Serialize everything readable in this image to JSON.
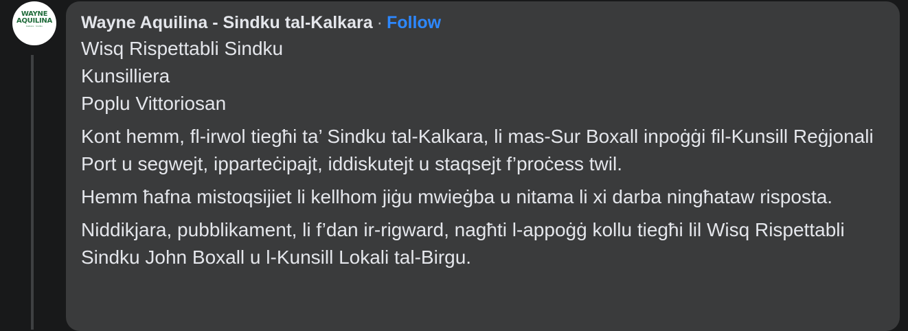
{
  "post": {
    "author": "Wayne Aquilina - Sindku tal-Kalkara",
    "separator": "·",
    "follow_label": "Follow",
    "avatar": {
      "logo_line1": "WAYNE",
      "logo_line2": "AQUILINA",
      "logo_sub": "Kalkara · Sindku"
    },
    "greeting_lines": [
      "Wisq Rispettabli Sindku",
      "Kunsilliera",
      "Poplu Vittoriosan"
    ],
    "paragraphs": [
      "Kont hemm, fl-irwol tiegħi ta’ Sindku tal-Kalkara, li mas-Sur Boxall inpoġġi fil-Kunsill Reġjonali Port u segwejt, ipparteċipajt, iddiskutejt u staqsejt f’proċess twil.",
      "Hemm ħafna mistoqsijiet li kellhom jiġu mwieġba u nitama li xi darba ningħataw risposta.",
      "Niddikjara, pubblikament, li f’dan ir-rigward, nagħti l-appoġġ kollu tiegħi lil Wisq Rispettabli Sindku John Boxall u l-Kunsill Lokali tal-Birgu."
    ]
  },
  "colors": {
    "background": "#18191a",
    "bubble": "#3a3b3c",
    "text": "#e4e6eb",
    "link": "#2d88ff",
    "logo_green": "#1f6b3a"
  }
}
